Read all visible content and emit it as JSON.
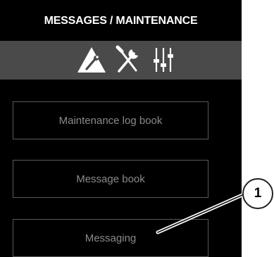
{
  "panel": {
    "title": "MESSAGES / MAINTENANCE",
    "icons": [
      "warning-wrench-icon",
      "tools-icon",
      "sliders-icon"
    ],
    "buttons": [
      "Maintenance log book",
      "Message book",
      "Messaging"
    ]
  },
  "callout": {
    "number": "1"
  },
  "colors": {
    "panel_bg": "#000000",
    "icon_bar_bg": "#4a4a4a",
    "button_border": "#5a5a5a",
    "button_text": "#8a8a8a",
    "title_text": "#ffffff"
  }
}
